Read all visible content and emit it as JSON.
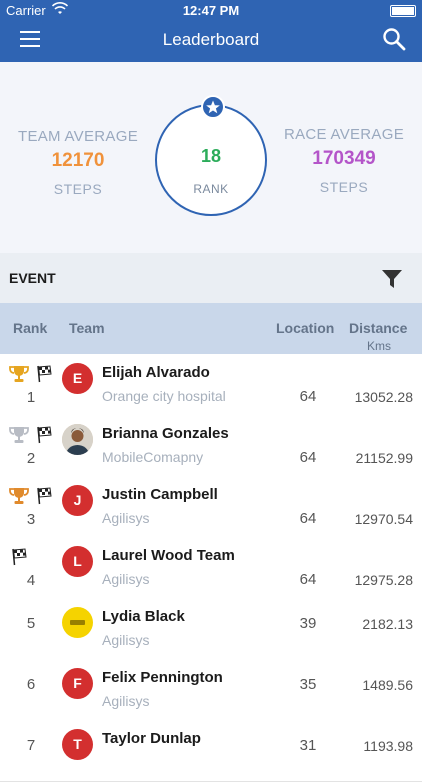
{
  "status_bar": {
    "carrier": "Carrier",
    "time": "12:47 PM"
  },
  "nav": {
    "title": "Leaderboard"
  },
  "summary": {
    "team_average": {
      "label": "TEAM AVERAGE",
      "value": "12170",
      "unit": "STEPS"
    },
    "rank": {
      "value": "18",
      "label": "RANK"
    },
    "race_average": {
      "label": "RACE AVERAGE",
      "value": "170349",
      "unit": "STEPS"
    }
  },
  "event": {
    "label": "EVENT"
  },
  "table": {
    "headers": {
      "rank": "Rank",
      "team": "Team",
      "location": "Location",
      "distance": "Distance",
      "distance_unit": "Kms"
    },
    "rows": [
      {
        "rank": "1",
        "initial": "E",
        "name": "Elijah Alvarado",
        "org": "Orange city hospital",
        "location": "64",
        "distance": "13052.28"
      },
      {
        "rank": "2",
        "initial": "",
        "name": "Brianna Gonzales",
        "org": "MobileComapny",
        "location": "64",
        "distance": "21152.99"
      },
      {
        "rank": "3",
        "initial": "J",
        "name": "Justin Campbell",
        "org": "Agilisys",
        "location": "64",
        "distance": "12970.54"
      },
      {
        "rank": "4",
        "initial": "L",
        "name": "Laurel Wood Team",
        "org": "Agilisys",
        "location": "64",
        "distance": "12975.28"
      },
      {
        "rank": "5",
        "initial": "",
        "name": "Lydia Black",
        "org": "Agilisys",
        "location": "39",
        "distance": "2182.13"
      },
      {
        "rank": "6",
        "initial": "F",
        "name": "Felix Pennington",
        "org": "Agilisys",
        "location": "35",
        "distance": "1489.56"
      },
      {
        "rank": "7",
        "initial": "T",
        "name": "Taylor Dunlap",
        "org": "",
        "location": "31",
        "distance": "1193.98"
      }
    ]
  },
  "colors": {
    "primary": "#2f64b3",
    "team_avg": "#f0923b",
    "race_avg": "#b455c9",
    "rank": "#2bac5a",
    "avatar_red": "#d32f2f",
    "avatar_yellow": "#f5d300"
  }
}
